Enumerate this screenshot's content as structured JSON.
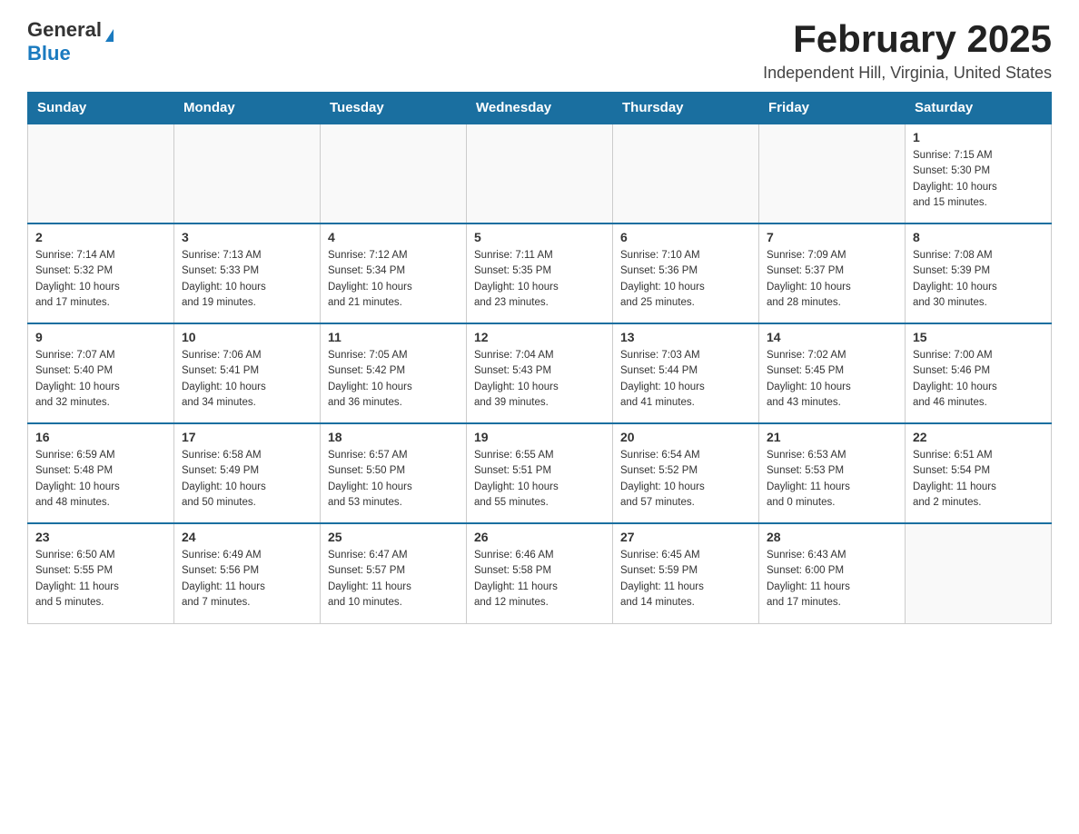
{
  "logo": {
    "general": "General",
    "blue": "Blue"
  },
  "header": {
    "month": "February 2025",
    "location": "Independent Hill, Virginia, United States"
  },
  "weekdays": [
    "Sunday",
    "Monday",
    "Tuesday",
    "Wednesday",
    "Thursday",
    "Friday",
    "Saturday"
  ],
  "weeks": [
    [
      {
        "day": "",
        "info": ""
      },
      {
        "day": "",
        "info": ""
      },
      {
        "day": "",
        "info": ""
      },
      {
        "day": "",
        "info": ""
      },
      {
        "day": "",
        "info": ""
      },
      {
        "day": "",
        "info": ""
      },
      {
        "day": "1",
        "info": "Sunrise: 7:15 AM\nSunset: 5:30 PM\nDaylight: 10 hours\nand 15 minutes."
      }
    ],
    [
      {
        "day": "2",
        "info": "Sunrise: 7:14 AM\nSunset: 5:32 PM\nDaylight: 10 hours\nand 17 minutes."
      },
      {
        "day": "3",
        "info": "Sunrise: 7:13 AM\nSunset: 5:33 PM\nDaylight: 10 hours\nand 19 minutes."
      },
      {
        "day": "4",
        "info": "Sunrise: 7:12 AM\nSunset: 5:34 PM\nDaylight: 10 hours\nand 21 minutes."
      },
      {
        "day": "5",
        "info": "Sunrise: 7:11 AM\nSunset: 5:35 PM\nDaylight: 10 hours\nand 23 minutes."
      },
      {
        "day": "6",
        "info": "Sunrise: 7:10 AM\nSunset: 5:36 PM\nDaylight: 10 hours\nand 25 minutes."
      },
      {
        "day": "7",
        "info": "Sunrise: 7:09 AM\nSunset: 5:37 PM\nDaylight: 10 hours\nand 28 minutes."
      },
      {
        "day": "8",
        "info": "Sunrise: 7:08 AM\nSunset: 5:39 PM\nDaylight: 10 hours\nand 30 minutes."
      }
    ],
    [
      {
        "day": "9",
        "info": "Sunrise: 7:07 AM\nSunset: 5:40 PM\nDaylight: 10 hours\nand 32 minutes."
      },
      {
        "day": "10",
        "info": "Sunrise: 7:06 AM\nSunset: 5:41 PM\nDaylight: 10 hours\nand 34 minutes."
      },
      {
        "day": "11",
        "info": "Sunrise: 7:05 AM\nSunset: 5:42 PM\nDaylight: 10 hours\nand 36 minutes."
      },
      {
        "day": "12",
        "info": "Sunrise: 7:04 AM\nSunset: 5:43 PM\nDaylight: 10 hours\nand 39 minutes."
      },
      {
        "day": "13",
        "info": "Sunrise: 7:03 AM\nSunset: 5:44 PM\nDaylight: 10 hours\nand 41 minutes."
      },
      {
        "day": "14",
        "info": "Sunrise: 7:02 AM\nSunset: 5:45 PM\nDaylight: 10 hours\nand 43 minutes."
      },
      {
        "day": "15",
        "info": "Sunrise: 7:00 AM\nSunset: 5:46 PM\nDaylight: 10 hours\nand 46 minutes."
      }
    ],
    [
      {
        "day": "16",
        "info": "Sunrise: 6:59 AM\nSunset: 5:48 PM\nDaylight: 10 hours\nand 48 minutes."
      },
      {
        "day": "17",
        "info": "Sunrise: 6:58 AM\nSunset: 5:49 PM\nDaylight: 10 hours\nand 50 minutes."
      },
      {
        "day": "18",
        "info": "Sunrise: 6:57 AM\nSunset: 5:50 PM\nDaylight: 10 hours\nand 53 minutes."
      },
      {
        "day": "19",
        "info": "Sunrise: 6:55 AM\nSunset: 5:51 PM\nDaylight: 10 hours\nand 55 minutes."
      },
      {
        "day": "20",
        "info": "Sunrise: 6:54 AM\nSunset: 5:52 PM\nDaylight: 10 hours\nand 57 minutes."
      },
      {
        "day": "21",
        "info": "Sunrise: 6:53 AM\nSunset: 5:53 PM\nDaylight: 11 hours\nand 0 minutes."
      },
      {
        "day": "22",
        "info": "Sunrise: 6:51 AM\nSunset: 5:54 PM\nDaylight: 11 hours\nand 2 minutes."
      }
    ],
    [
      {
        "day": "23",
        "info": "Sunrise: 6:50 AM\nSunset: 5:55 PM\nDaylight: 11 hours\nand 5 minutes."
      },
      {
        "day": "24",
        "info": "Sunrise: 6:49 AM\nSunset: 5:56 PM\nDaylight: 11 hours\nand 7 minutes."
      },
      {
        "day": "25",
        "info": "Sunrise: 6:47 AM\nSunset: 5:57 PM\nDaylight: 11 hours\nand 10 minutes."
      },
      {
        "day": "26",
        "info": "Sunrise: 6:46 AM\nSunset: 5:58 PM\nDaylight: 11 hours\nand 12 minutes."
      },
      {
        "day": "27",
        "info": "Sunrise: 6:45 AM\nSunset: 5:59 PM\nDaylight: 11 hours\nand 14 minutes."
      },
      {
        "day": "28",
        "info": "Sunrise: 6:43 AM\nSunset: 6:00 PM\nDaylight: 11 hours\nand 17 minutes."
      },
      {
        "day": "",
        "info": ""
      }
    ]
  ]
}
